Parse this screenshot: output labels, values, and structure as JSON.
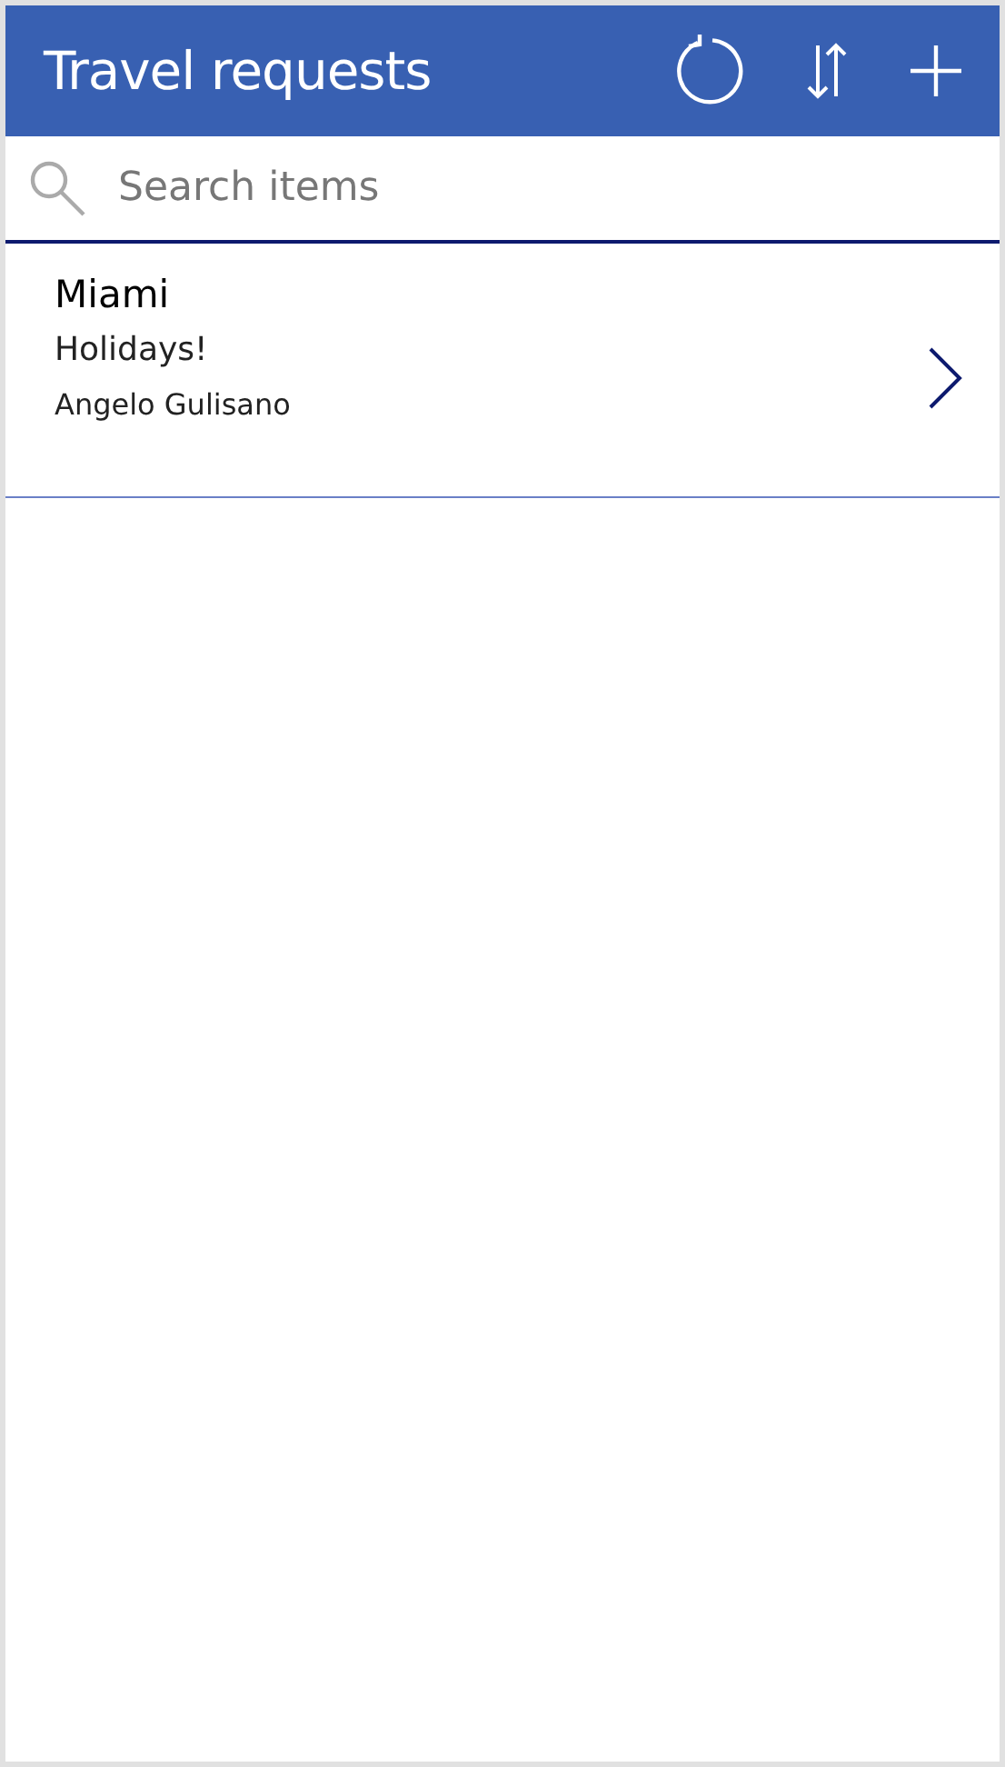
{
  "header": {
    "title": "Travel requests"
  },
  "search": {
    "placeholder": "Search items"
  },
  "items": [
    {
      "title": "Miami",
      "subtitle": "Holidays!",
      "person": "Angelo Gulisano"
    }
  ]
}
